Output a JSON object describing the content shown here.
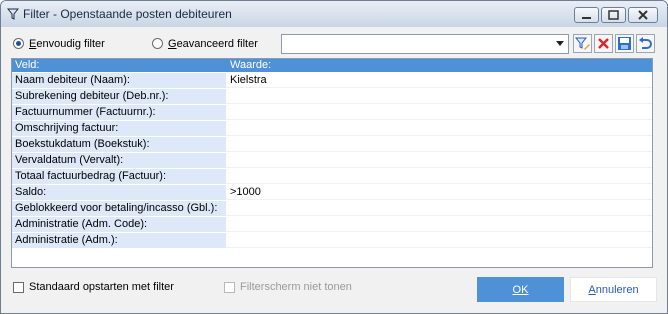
{
  "window": {
    "title": "Filter - Openstaande posten debiteuren"
  },
  "mode": {
    "simple_label": "Eenvoudig filter",
    "advanced_label": "Geavanceerd filter",
    "selected": "simple"
  },
  "toolbar": {
    "combo_value": "",
    "icons": [
      "edit-filter-icon",
      "delete-icon",
      "save-icon",
      "undo-icon"
    ]
  },
  "grid": {
    "header_field": "Veld:",
    "header_value": "Waarde:",
    "rows": [
      {
        "field": "Naam debiteur (Naam):",
        "value": "Kielstra"
      },
      {
        "field": "Subrekening debiteur (Deb.nr.):",
        "value": ""
      },
      {
        "field": "Factuurnummer (Factuurnr.):",
        "value": ""
      },
      {
        "field": "Omschrijving factuur:",
        "value": ""
      },
      {
        "field": "Boekstukdatum (Boekstuk):",
        "value": ""
      },
      {
        "field": "Vervaldatum (Vervalt):",
        "value": ""
      },
      {
        "field": "Totaal factuurbedrag (Factuur):",
        "value": ""
      },
      {
        "field": "Saldo:",
        "value": ">1000"
      },
      {
        "field": "Geblokkeerd voor betaling/incasso (Gbl.):",
        "value": ""
      },
      {
        "field": "Administratie (Adm. Code):",
        "value": ""
      },
      {
        "field": "Administratie (Adm.):",
        "value": ""
      }
    ]
  },
  "footer": {
    "start_with_filter_label": "Standaard opstarten met filter",
    "hide_filter_label": "Filterscherm niet tonen",
    "ok_label": "OK",
    "cancel_label": "Annuleren"
  },
  "colors": {
    "accent": "#4f91d7",
    "field_bg": "#dde9f8"
  }
}
